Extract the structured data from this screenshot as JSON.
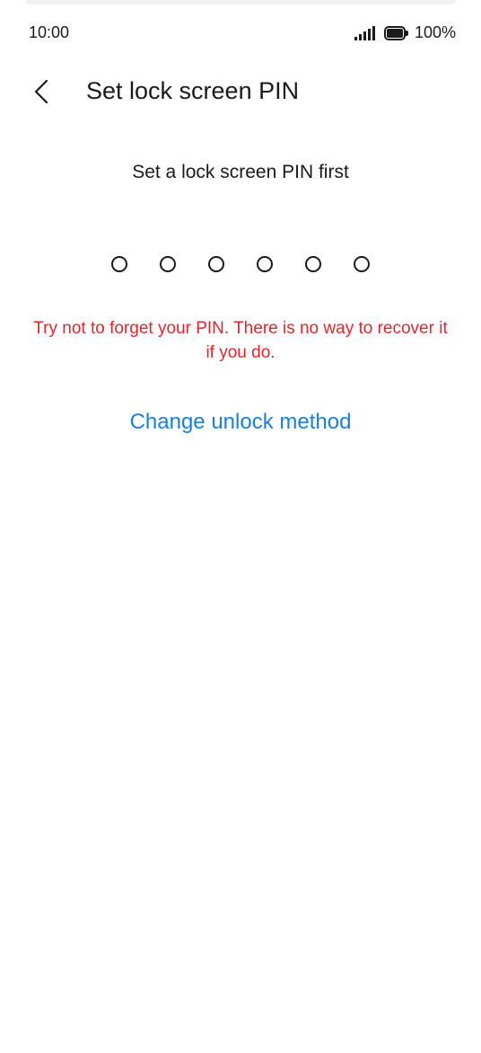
{
  "status_bar": {
    "time": "10:00",
    "battery_percent": "100%",
    "icons": [
      "signal-icon",
      "battery-icon"
    ]
  },
  "header": {
    "back_icon": "chevron-left-icon",
    "title": "Set lock screen PIN"
  },
  "main": {
    "instruction": "Set a lock screen PIN first",
    "pin_length": 6,
    "pin_entered": 0,
    "warning": "Try not to forget your PIN. There is no way to recover it if you do.",
    "change_method_label": "Change unlock method"
  },
  "colors": {
    "warning": "#e0262c",
    "link": "#1a7fd6",
    "text": "#1a1a1a",
    "background": "#ffffff"
  }
}
